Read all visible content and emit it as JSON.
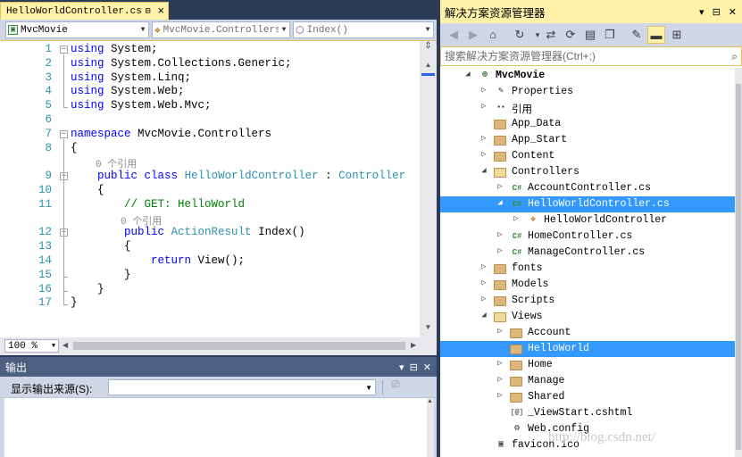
{
  "editor": {
    "tab_title": "HelloWorldController.cs",
    "nav_project": "MvcMovie",
    "nav_namespace": "MvcMovie.Controllers.",
    "nav_member": "Index()",
    "zoom": "100 %",
    "lines": [
      {
        "num": "1",
        "segments": [
          {
            "t": "using",
            "c": "kw"
          },
          {
            "t": " System;",
            "c": ""
          }
        ]
      },
      {
        "num": "2",
        "segments": [
          {
            "t": "using",
            "c": "kw"
          },
          {
            "t": " System.Collections.Generic;",
            "c": ""
          }
        ]
      },
      {
        "num": "3",
        "segments": [
          {
            "t": "using",
            "c": "kw"
          },
          {
            "t": " System.Linq;",
            "c": ""
          }
        ]
      },
      {
        "num": "4",
        "segments": [
          {
            "t": "using",
            "c": "kw"
          },
          {
            "t": " System.Web;",
            "c": ""
          }
        ]
      },
      {
        "num": "5",
        "segments": [
          {
            "t": "using",
            "c": "kw"
          },
          {
            "t": " System.Web.Mvc;",
            "c": ""
          }
        ]
      },
      {
        "num": "6",
        "segments": []
      },
      {
        "num": "7",
        "segments": [
          {
            "t": "namespace",
            "c": "kw"
          },
          {
            "t": " MvcMovie.Controllers",
            "c": ""
          }
        ]
      },
      {
        "num": "8",
        "segments": [
          {
            "t": "{",
            "c": ""
          }
        ]
      },
      {
        "num": "9",
        "segments": [
          {
            "t": "    public",
            "c": "kw"
          },
          {
            "t": " ",
            "c": ""
          },
          {
            "t": "class",
            "c": "kw"
          },
          {
            "t": " ",
            "c": ""
          },
          {
            "t": "HelloWorldController",
            "c": "ty"
          },
          {
            "t": " : ",
            "c": ""
          },
          {
            "t": "Controller",
            "c": "ty"
          }
        ]
      },
      {
        "num": "10",
        "segments": [
          {
            "t": "    {",
            "c": ""
          }
        ]
      },
      {
        "num": "11",
        "segments": [
          {
            "t": "        // GET: HelloWorld",
            "c": "cm"
          }
        ]
      },
      {
        "num": "12",
        "segments": [
          {
            "t": "        public",
            "c": "kw"
          },
          {
            "t": " ",
            "c": ""
          },
          {
            "t": "ActionResult",
            "c": "ty"
          },
          {
            "t": " Index()",
            "c": ""
          }
        ]
      },
      {
        "num": "13",
        "segments": [
          {
            "t": "        {",
            "c": ""
          }
        ]
      },
      {
        "num": "14",
        "segments": [
          {
            "t": "            return",
            "c": "kw"
          },
          {
            "t": " View();",
            "c": ""
          }
        ]
      },
      {
        "num": "15",
        "segments": [
          {
            "t": "        }",
            "c": ""
          }
        ]
      },
      {
        "num": "16",
        "segments": [
          {
            "t": "    }",
            "c": ""
          }
        ]
      },
      {
        "num": "17",
        "segments": [
          {
            "t": "}",
            "c": ""
          }
        ]
      }
    ],
    "lens_text": "0 个引用"
  },
  "output": {
    "title": "输出",
    "source_label": "显示输出来源(S):",
    "source_value": ""
  },
  "solution": {
    "title": "解决方案资源管理器",
    "search_placeholder": "搜索解决方案资源管理器(Ctrl+;)",
    "items": [
      {
        "label": "MvcMovie",
        "level": 0,
        "expander": "down",
        "icon": "globe-icon"
      },
      {
        "label": "Properties",
        "level": 1,
        "expander": "right",
        "icon": "wrench-icon"
      },
      {
        "label": "引用",
        "level": 1,
        "expander": "right",
        "icon": "references-icon"
      },
      {
        "label": "App_Data",
        "level": 1,
        "expander": "",
        "icon": "folder-icon"
      },
      {
        "label": "App_Start",
        "level": 1,
        "expander": "right",
        "icon": "folder-icon"
      },
      {
        "label": "Content",
        "level": 1,
        "expander": "right",
        "icon": "folder-icon"
      },
      {
        "label": "Controllers",
        "level": 1,
        "expander": "down",
        "icon": "folder-open-icon"
      },
      {
        "label": "AccountController.cs",
        "level": 2,
        "expander": "right",
        "icon": "csharp-file-icon"
      },
      {
        "label": "HelloWorldController.cs",
        "level": 2,
        "expander": "down",
        "icon": "csharp-file-icon",
        "selected": true
      },
      {
        "label": "HelloWorldController",
        "level": 3,
        "expander": "right",
        "icon": "class-icon"
      },
      {
        "label": "HomeController.cs",
        "level": 2,
        "expander": "right",
        "icon": "csharp-file-icon"
      },
      {
        "label": "ManageController.cs",
        "level": 2,
        "expander": "right",
        "icon": "csharp-file-icon"
      },
      {
        "label": "fonts",
        "level": 1,
        "expander": "right",
        "icon": "folder-icon"
      },
      {
        "label": "Models",
        "level": 1,
        "expander": "right",
        "icon": "folder-icon"
      },
      {
        "label": "Scripts",
        "level": 1,
        "expander": "right",
        "icon": "folder-icon"
      },
      {
        "label": "Views",
        "level": 1,
        "expander": "down",
        "icon": "folder-open-icon"
      },
      {
        "label": "Account",
        "level": 2,
        "expander": "right",
        "icon": "folder-icon"
      },
      {
        "label": "HelloWorld",
        "level": 2,
        "expander": "",
        "icon": "folder-icon",
        "selected": true
      },
      {
        "label": "Home",
        "level": 2,
        "expander": "right",
        "icon": "folder-icon"
      },
      {
        "label": "Manage",
        "level": 2,
        "expander": "right",
        "icon": "folder-icon"
      },
      {
        "label": "Shared",
        "level": 2,
        "expander": "right",
        "icon": "folder-icon"
      },
      {
        "label": "_ViewStart.cshtml",
        "level": 2,
        "expander": "",
        "icon": "razor-file-icon"
      },
      {
        "label": "Web.config",
        "level": 2,
        "expander": "",
        "icon": "config-file-icon"
      },
      {
        "label": "favicon.ico",
        "level": 1,
        "expander": "",
        "icon": "image-file-icon"
      }
    ]
  },
  "watermark": "http://blog.csdn.net/",
  "colors": {
    "keyword": "#0000ff",
    "type": "#2b91af",
    "comment": "#008000",
    "selection": "#3399ff",
    "active_tab": "#fff1a8",
    "chrome_dark": "#2b3c59"
  }
}
